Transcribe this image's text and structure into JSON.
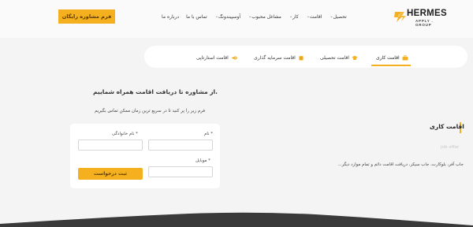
{
  "header": {
    "cta_label": "فرم مشاوره رایگان",
    "nav": [
      {
        "label": "تحصیل",
        "dropdown": true
      },
      {
        "label": "اقامت",
        "dropdown": true
      },
      {
        "label": "کار",
        "dropdown": true
      },
      {
        "label": "مشاغل محبوب",
        "dropdown": true
      },
      {
        "label": "آوسپیندونگ",
        "dropdown": true
      },
      {
        "label": "تماس با ما",
        "dropdown": false
      },
      {
        "label": "درباره ما",
        "dropdown": false
      }
    ],
    "logo": {
      "name": "HERMES",
      "sub": "APPLY . GROUP"
    }
  },
  "tabs": [
    {
      "label": "اقامت کاری",
      "icon": "briefcase-icon",
      "active": true
    },
    {
      "label": "اقامت تحصیلی",
      "icon": "graduation-cap-icon",
      "active": false
    },
    {
      "label": "اقامت سرمایه گذاری",
      "icon": "coins-icon",
      "active": false
    },
    {
      "label": "اقامت استارتاپی",
      "icon": "rocket-icon",
      "active": false
    }
  ],
  "intro": {
    "heading": "از مشاوره تا دریافت اقامت همراه شماییم.",
    "subheading": "فرم زیر را پر کنید تا در سریع ترین زمان ممکن تماس بگیریم"
  },
  "form": {
    "first_name_label": "نام *",
    "last_name_label": "نام خانوادگی *",
    "mobile_label": "موبایل *",
    "first_name_value": "",
    "last_name_value": "",
    "mobile_value": "",
    "submit_label": "ثبت درخواست"
  },
  "side": {
    "title": "اقامت کاری",
    "label": "job offer",
    "description": "جاب آفر، بلوکارت، جاب سیکر، دریافت اقامت دائم و تمام موارد دیگر..."
  },
  "colors": {
    "accent": "#f4b01e",
    "background": "#f4f4f4",
    "card": "#ffffff",
    "dark": "#1e1e1e"
  }
}
